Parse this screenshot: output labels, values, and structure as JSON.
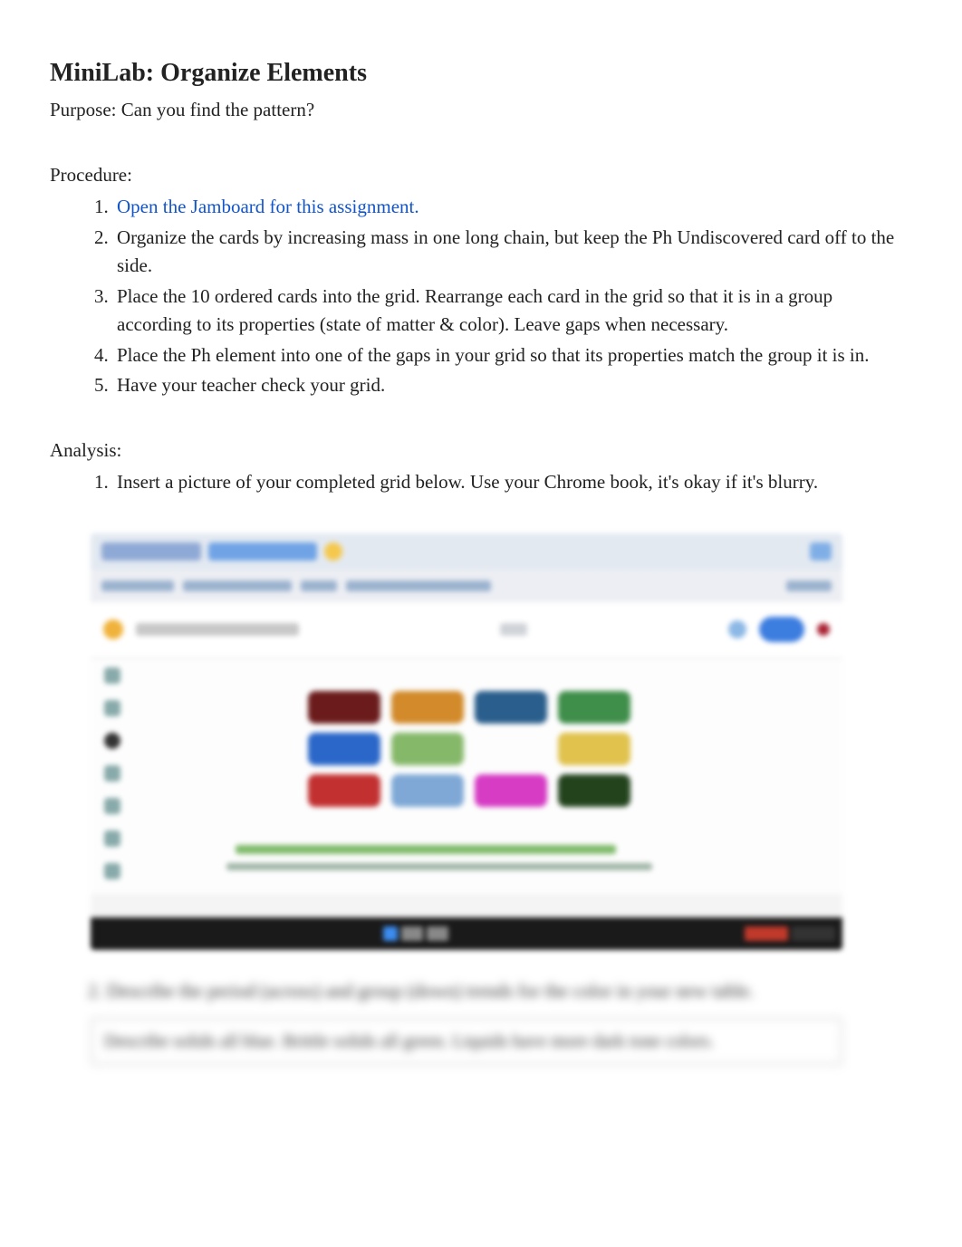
{
  "title": "MiniLab: Organize Elements",
  "purpose": "Purpose: Can you find the pattern?",
  "procedure_label": "Procedure:",
  "procedure": [
    {
      "text": "Open the Jamboard for this assignment.",
      "link": true
    },
    {
      "text": "Organize the cards by increasing mass in one long chain, but keep the Ph Undiscovered card off to the side."
    },
    {
      "text": "Place the 10 ordered cards into the grid. Rearrange each card in the grid so that it is in a group according to its properties (state of matter & color). Leave gaps when necessary."
    },
    {
      "text": "Place the Ph element into one of the gaps in your grid so that its properties match the group it is in."
    },
    {
      "text": "Have your teacher check your grid."
    }
  ],
  "analysis_label": "Analysis:",
  "analysis": [
    {
      "text": "Insert a picture of your completed grid below. Use your Chrome book, it's okay if it's blurry."
    }
  ],
  "blurred_question": "2.  Describe the period (across) and group (down) trends for the color in your new table.",
  "blurred_answer": "Describe solids all blue. Brittle solids all green. Liquids have more dark tone colors.",
  "figure": {
    "grid_colors": [
      "#6b1b1b",
      "#d28a2a",
      "#2a5e8c",
      "#3f8e4a",
      "#2a67c9",
      "#86b86a",
      "transparent",
      "#e0c24d",
      "#c23030",
      "#7fa8d6",
      "#d63cc4",
      "#23431d"
    ]
  }
}
